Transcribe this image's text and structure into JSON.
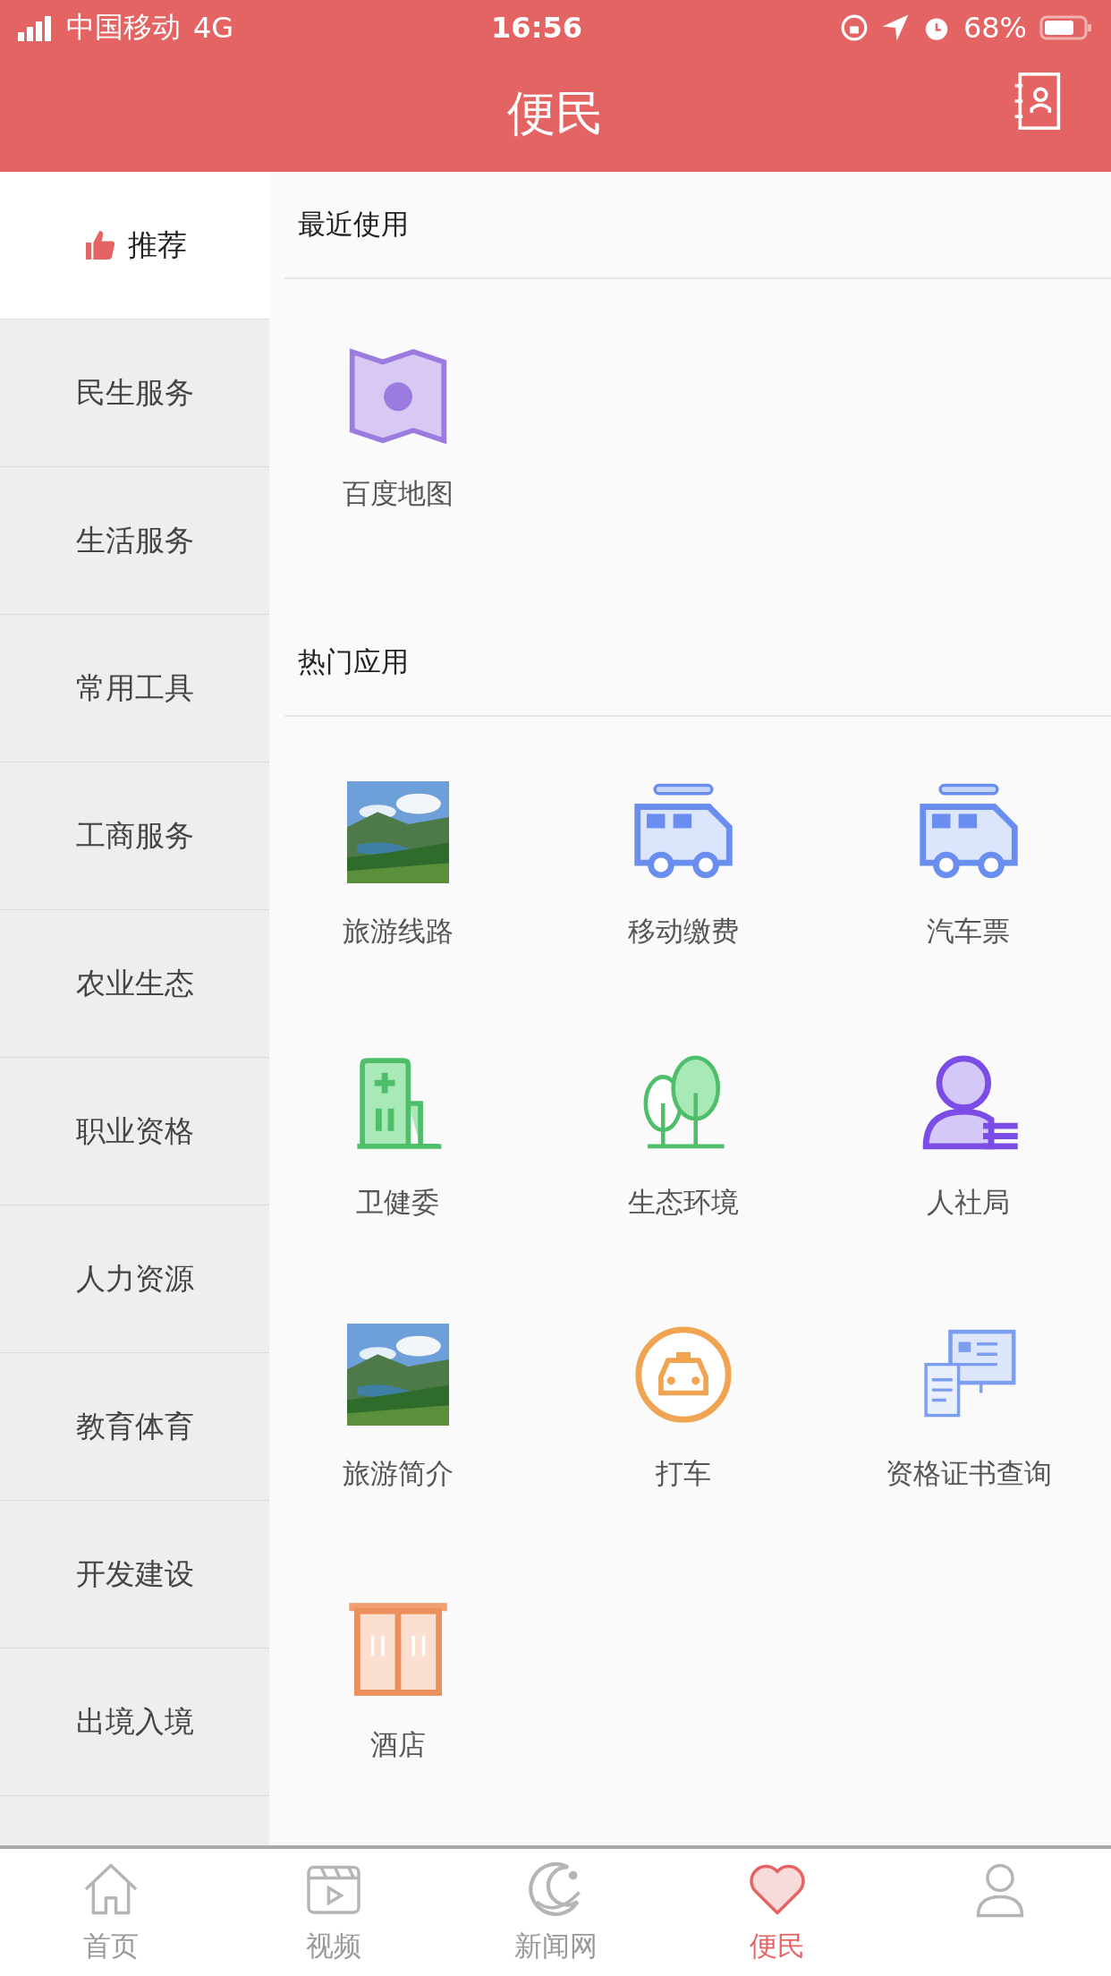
{
  "status_bar": {
    "carrier": "中国移动",
    "network": "4G",
    "time": "16:56",
    "battery": "68%"
  },
  "header": {
    "title": "便民"
  },
  "sidebar": {
    "items": [
      {
        "label": "推荐",
        "selected": true
      },
      {
        "label": "民生服务",
        "selected": false
      },
      {
        "label": "生活服务",
        "selected": false
      },
      {
        "label": "常用工具",
        "selected": false
      },
      {
        "label": "工商服务",
        "selected": false
      },
      {
        "label": "农业生态",
        "selected": false
      },
      {
        "label": "职业资格",
        "selected": false
      },
      {
        "label": "人力资源",
        "selected": false
      },
      {
        "label": "教育体育",
        "selected": false
      },
      {
        "label": "开发建设",
        "selected": false
      },
      {
        "label": "出境入境",
        "selected": false
      }
    ]
  },
  "sections": [
    {
      "title": "最近使用",
      "items": [
        {
          "label": "百度地图",
          "kind": "map"
        }
      ]
    },
    {
      "title": "热门应用",
      "items": [
        {
          "label": "旅游线路",
          "kind": "picture"
        },
        {
          "label": "移动缴费",
          "kind": "bus"
        },
        {
          "label": "汽车票",
          "kind": "bus"
        },
        {
          "label": "卫健委",
          "kind": "hospital"
        },
        {
          "label": "生态环境",
          "kind": "trees"
        },
        {
          "label": "人社局",
          "kind": "person"
        },
        {
          "label": "旅游简介",
          "kind": "picture"
        },
        {
          "label": "打车",
          "kind": "taxi"
        },
        {
          "label": "资格证书查询",
          "kind": "certificate"
        },
        {
          "label": "酒店",
          "kind": "hotel"
        }
      ]
    }
  ],
  "tab_bar": [
    {
      "label": "首页",
      "kind": "home",
      "selected": false
    },
    {
      "label": "视频",
      "kind": "video",
      "selected": false
    },
    {
      "label": "新闻网",
      "kind": "news",
      "selected": false
    },
    {
      "label": "便民",
      "kind": "heart",
      "selected": true
    },
    {
      "kind": "person",
      "selected": false
    }
  ]
}
